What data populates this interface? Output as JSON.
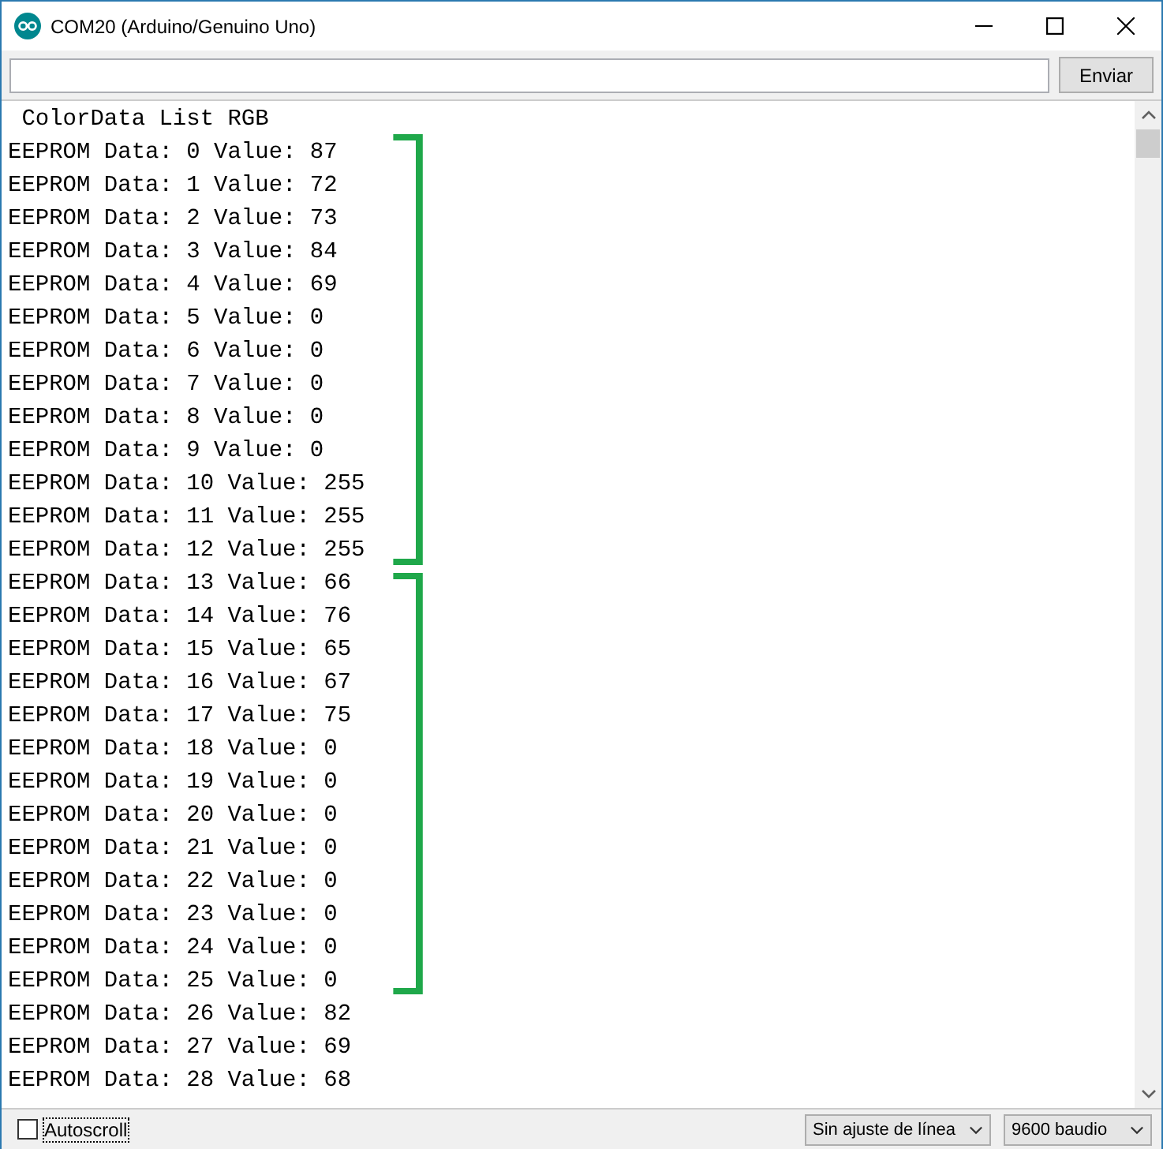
{
  "window": {
    "title": "COM20 (Arduino/Genuino Uno)"
  },
  "send_button": "Enviar",
  "output_lines": [
    " ColorData List RGB",
    "EEPROM Data: 0 Value: 87",
    "EEPROM Data: 1 Value: 72",
    "EEPROM Data: 2 Value: 73",
    "EEPROM Data: 3 Value: 84",
    "EEPROM Data: 4 Value: 69",
    "EEPROM Data: 5 Value: 0",
    "EEPROM Data: 6 Value: 0",
    "EEPROM Data: 7 Value: 0",
    "EEPROM Data: 8 Value: 0",
    "EEPROM Data: 9 Value: 0",
    "EEPROM Data: 10 Value: 255",
    "EEPROM Data: 11 Value: 255",
    "EEPROM Data: 12 Value: 255",
    "EEPROM Data: 13 Value: 66",
    "EEPROM Data: 14 Value: 76",
    "EEPROM Data: 15 Value: 65",
    "EEPROM Data: 16 Value: 67",
    "EEPROM Data: 17 Value: 75",
    "EEPROM Data: 18 Value: 0",
    "EEPROM Data: 19 Value: 0",
    "EEPROM Data: 20 Value: 0",
    "EEPROM Data: 21 Value: 0",
    "EEPROM Data: 22 Value: 0",
    "EEPROM Data: 23 Value: 0",
    "EEPROM Data: 24 Value: 0",
    "EEPROM Data: 25 Value: 0",
    "EEPROM Data: 26 Value: 82",
    "EEPROM Data: 27 Value: 69",
    "EEPROM Data: 28 Value: 68"
  ],
  "autoscroll": {
    "label": "Autoscroll",
    "checked": false
  },
  "line_ending": "Sin ajuste de línea",
  "baud_rate": "9600 baudio"
}
